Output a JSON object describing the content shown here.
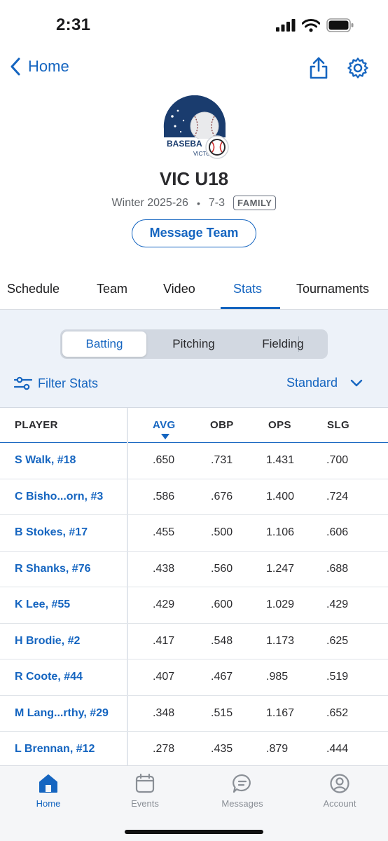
{
  "status_bar": {
    "time": "2:31"
  },
  "nav": {
    "back_label": "Home"
  },
  "team": {
    "logo_text": "BASEBA",
    "logo_subtext": "VICTORIA",
    "name": "VIC U18",
    "season": "Winter 2025-26",
    "separator": "•",
    "record": "7-3",
    "badge": "FAMILY"
  },
  "message_button": "Message Team",
  "tabs": [
    "Schedule",
    "Team",
    "Video",
    "Stats",
    "Tournaments"
  ],
  "active_tab": "Stats",
  "segments": [
    "Batting",
    "Pitching",
    "Fielding"
  ],
  "active_segment": "Batting",
  "filter_label": "Filter Stats",
  "view_select": "Standard",
  "table": {
    "headers": [
      "PLAYER",
      "AVG",
      "OBP",
      "OPS",
      "SLG"
    ],
    "sorted_column": "AVG",
    "rows": [
      {
        "player": "S Walk, #18",
        "avg": ".650",
        "obp": ".731",
        "ops": "1.431",
        "slg": ".700"
      },
      {
        "player": "C Bisho...orn, #3",
        "avg": ".586",
        "obp": ".676",
        "ops": "1.400",
        "slg": ".724"
      },
      {
        "player": "B Stokes, #17",
        "avg": ".455",
        "obp": ".500",
        "ops": "1.106",
        "slg": ".606"
      },
      {
        "player": "R Shanks, #76",
        "avg": ".438",
        "obp": ".560",
        "ops": "1.247",
        "slg": ".688"
      },
      {
        "player": "K Lee, #55",
        "avg": ".429",
        "obp": ".600",
        "ops": "1.029",
        "slg": ".429"
      },
      {
        "player": "H Brodie, #2",
        "avg": ".417",
        "obp": ".548",
        "ops": "1.173",
        "slg": ".625"
      },
      {
        "player": "R Coote, #44",
        "avg": ".407",
        "obp": ".467",
        "ops": ".985",
        "slg": ".519"
      },
      {
        "player": "M Lang...rthy, #29",
        "avg": ".348",
        "obp": ".515",
        "ops": "1.167",
        "slg": ".652"
      },
      {
        "player": "L Brennan, #12",
        "avg": ".278",
        "obp": ".435",
        "ops": ".879",
        "slg": ".444"
      }
    ]
  },
  "bottom_nav": [
    {
      "label": "Home",
      "icon": "home-icon",
      "active": true
    },
    {
      "label": "Events",
      "icon": "calendar-icon",
      "active": false
    },
    {
      "label": "Messages",
      "icon": "chat-icon",
      "active": false
    },
    {
      "label": "Account",
      "icon": "person-icon",
      "active": false
    }
  ],
  "colors": {
    "accent": "#1565c0",
    "panel_bg": "#edf2f9",
    "text": "#1c1c1e",
    "muted": "#8a8f96"
  }
}
